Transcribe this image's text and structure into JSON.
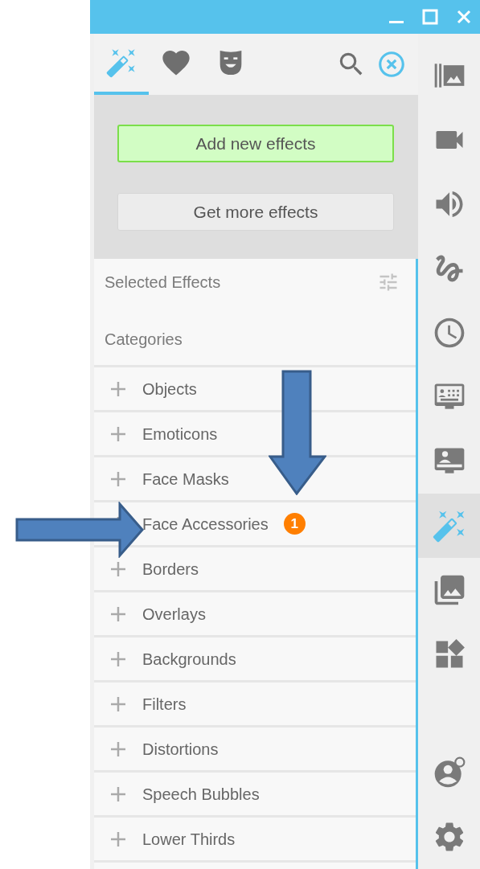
{
  "tabs": [
    {
      "kind": "effects",
      "selected": true
    },
    {
      "kind": "favorites",
      "selected": false
    },
    {
      "kind": "masks",
      "selected": false
    }
  ],
  "buttons": [
    {
      "label": "Add new effects",
      "kind": "primary"
    },
    {
      "label": "Get more effects",
      "kind": "secondary"
    }
  ],
  "selected_effects": {
    "title": "Selected Effects"
  },
  "categories": {
    "title": "Categories",
    "items": [
      {
        "label": "Objects"
      },
      {
        "label": "Emoticons"
      },
      {
        "label": "Face Masks"
      },
      {
        "label": "Face Accessories",
        "badge": "1"
      },
      {
        "label": "Borders"
      },
      {
        "label": "Overlays"
      },
      {
        "label": "Backgrounds"
      },
      {
        "label": "Filters"
      },
      {
        "label": "Distortions"
      },
      {
        "label": "Speech Bubbles"
      },
      {
        "label": "Lower Thirds"
      }
    ]
  },
  "rail": {
    "items": [
      {
        "kind": "library",
        "selected": false
      },
      {
        "kind": "camera",
        "selected": false
      },
      {
        "kind": "audio",
        "selected": false
      },
      {
        "kind": "drawing",
        "selected": false
      },
      {
        "kind": "clock",
        "selected": false
      },
      {
        "kind": "keyboard",
        "selected": false
      },
      {
        "kind": "presenter",
        "selected": false
      },
      {
        "kind": "effects",
        "selected": true
      },
      {
        "kind": "gallery",
        "selected": false
      },
      {
        "kind": "widgets",
        "selected": false
      }
    ],
    "bottom": [
      {
        "kind": "account"
      },
      {
        "kind": "settings"
      }
    ]
  }
}
